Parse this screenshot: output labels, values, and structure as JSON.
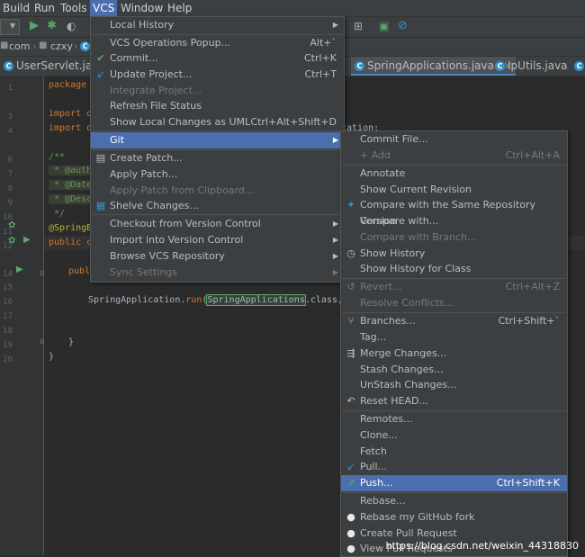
{
  "menubar": {
    "items": [
      "Build",
      "Run",
      "Tools",
      "VCS",
      "Window",
      "Help"
    ]
  },
  "navbar": {
    "crumbs": [
      "com",
      "czxy"
    ]
  },
  "tabs": {
    "left": "UserServlet.java",
    "items": [
      "SpringApplications.java",
      "IpUtils.java"
    ]
  },
  "code": {
    "package": "package c",
    "import1": "import or",
    "import2": "import or",
    "import2_tail": "cation;",
    "doc_open": "/**",
    "doc_author": " * @autho",
    "doc_date": " * @Date:",
    "doc_desc": " * @Descr",
    "doc_close": " */",
    "annotation": "@SpringBo",
    "class_decl": "public cl",
    "main_decl": "publi",
    "run_prefix": "SpringApplication.",
    "run_method": "run",
    "run_arg": "SpringApplications",
    "run_suffix": ".class,args)",
    "close1": "}",
    "close2": "}"
  },
  "vcs_menu": {
    "items": [
      {
        "label": "Local History",
        "submenu": true
      },
      {
        "label": "VCS Operations Popup...",
        "shortcut": "Alt+`"
      },
      {
        "label": "Commit...",
        "shortcut": "Ctrl+K",
        "icon": "check-icon"
      },
      {
        "label": "Update Project...",
        "shortcut": "Ctrl+T",
        "icon": "update-arrow-icon"
      },
      {
        "label": "Integrate Project...",
        "disabled": true
      },
      {
        "label": "Refresh File Status"
      },
      {
        "label": "Show Local Changes as UML",
        "shortcut": "Ctrl+Alt+Shift+D"
      },
      {
        "label": "Git",
        "submenu": true,
        "highlighted": true
      },
      {
        "label": "Create Patch...",
        "icon": "patch-icon"
      },
      {
        "label": "Apply Patch..."
      },
      {
        "label": "Apply Patch from Clipboard...",
        "disabled": true
      },
      {
        "label": "Shelve Changes...",
        "icon": "shelve-icon"
      },
      {
        "label": "Checkout from Version Control",
        "submenu": true
      },
      {
        "label": "Import into Version Control",
        "submenu": true
      },
      {
        "label": "Browse VCS Repository",
        "submenu": true
      },
      {
        "label": "Sync Settings",
        "disabled": true,
        "submenu": true
      }
    ]
  },
  "git_menu": {
    "items": [
      {
        "label": "Commit File..."
      },
      {
        "label": "+ Add",
        "shortcut": "Ctrl+Alt+A",
        "disabled": true
      },
      {
        "label": "Annotate"
      },
      {
        "label": "Show Current Revision"
      },
      {
        "label": "Compare with the Same Repository Version",
        "icon": "compare-icon"
      },
      {
        "label": "Compare with..."
      },
      {
        "label": "Compare with Branch...",
        "disabled": true
      },
      {
        "label": "Show History",
        "icon": "history-icon"
      },
      {
        "label": "Show History for Class"
      },
      {
        "label": "Revert...",
        "shortcut": "Ctrl+Alt+Z",
        "disabled": true,
        "icon": "revert-icon"
      },
      {
        "label": "Resolve Conflicts...",
        "disabled": true
      },
      {
        "label": "Branches...",
        "shortcut": "Ctrl+Shift+`",
        "icon": "branch-icon"
      },
      {
        "label": "Tag..."
      },
      {
        "label": "Merge Changes...",
        "icon": "merge-icon"
      },
      {
        "label": "Stash Changes..."
      },
      {
        "label": "UnStash Changes..."
      },
      {
        "label": "Reset HEAD...",
        "icon": "reset-icon"
      },
      {
        "label": "Remotes..."
      },
      {
        "label": "Clone..."
      },
      {
        "label": "Fetch"
      },
      {
        "label": "Pull...",
        "icon": "pull-icon"
      },
      {
        "label": "Push...",
        "shortcut": "Ctrl+Shift+K",
        "highlighted": true,
        "icon": "push-icon"
      },
      {
        "label": "Rebase..."
      },
      {
        "label": "Rebase my GitHub fork",
        "icon": "github-icon"
      },
      {
        "label": "Create Pull Request",
        "icon": "github-icon"
      },
      {
        "label": "View Pull Requests",
        "icon": "github-icon"
      }
    ]
  },
  "watermark": "https://blog.csdn.net/weixin_44318830",
  "colors": {
    "highlight": "#4b6eaf",
    "menu_bg": "#3c3f41",
    "editor_bg": "#2b2b2b"
  }
}
